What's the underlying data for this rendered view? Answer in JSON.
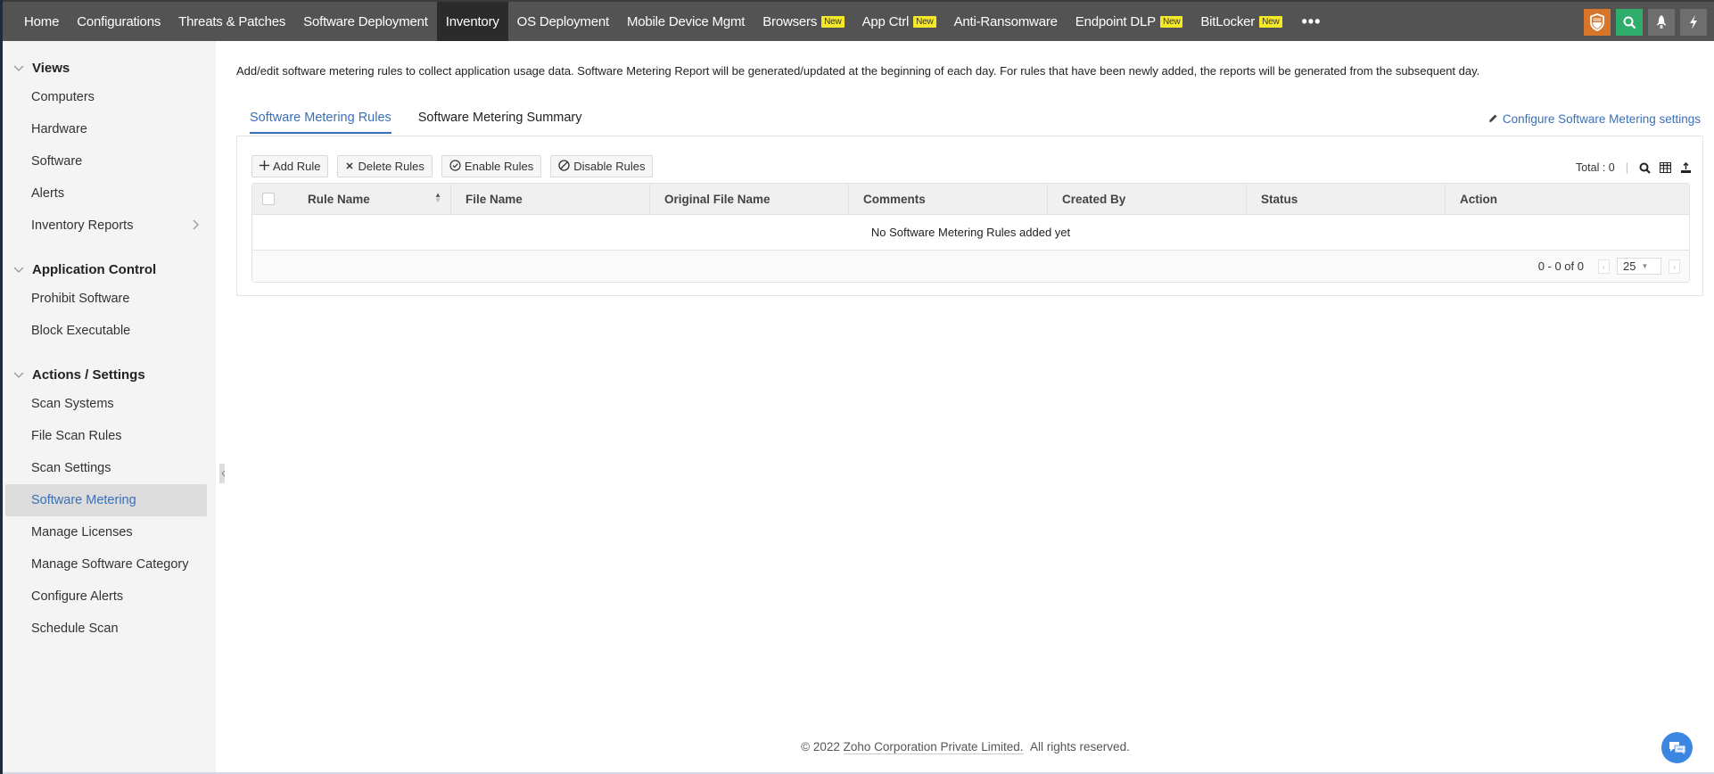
{
  "topnav": {
    "items": [
      {
        "label": "Home",
        "active": false
      },
      {
        "label": "Configurations",
        "active": false
      },
      {
        "label": "Threats & Patches",
        "active": false
      },
      {
        "label": "Software Deployment",
        "active": false
      },
      {
        "label": "Inventory",
        "active": true
      },
      {
        "label": "OS Deployment",
        "active": false
      },
      {
        "label": "Mobile Device Mgmt",
        "active": false
      },
      {
        "label": "Browsers",
        "badge": "New"
      },
      {
        "label": "App Ctrl",
        "badge": "New"
      },
      {
        "label": "Anti-Ransomware"
      },
      {
        "label": "Endpoint DLP",
        "badge": "New"
      },
      {
        "label": "BitLocker",
        "badge": "New"
      }
    ],
    "more": "•••",
    "right_icons": [
      "shield-icon",
      "search-icon",
      "rocket-icon",
      "lightning-icon"
    ],
    "colors": {
      "shield": "#d7762a",
      "search": "#2eae6a"
    }
  },
  "sidebar": {
    "sections": [
      {
        "title": "Views",
        "items": [
          "Computers",
          "Hardware",
          "Software",
          "Alerts",
          "Inventory Reports"
        ]
      },
      {
        "title": "Application Control",
        "items": [
          "Prohibit Software",
          "Block Executable"
        ]
      },
      {
        "title": "Actions / Settings",
        "items": [
          "Scan Systems",
          "File Scan Rules",
          "Scan Settings",
          "Software Metering",
          "Manage Licenses",
          "Manage Software Category",
          "Configure Alerts",
          "Schedule Scan"
        ]
      }
    ],
    "selected": "Software Metering"
  },
  "main": {
    "description": "Add/edit software metering rules to collect application usage data. Software Metering Report will be generated/updated at the beginning of each day. For rules that have been newly added, the reports will be generated from the subsequent day.",
    "tabs": [
      {
        "label": "Software Metering Rules",
        "active": true
      },
      {
        "label": "Software Metering Summary",
        "active": false
      }
    ],
    "config_link": "Configure Software Metering settings",
    "toolbar": {
      "add": "Add Rule",
      "delete": "Delete Rules",
      "enable": "Enable Rules",
      "disable": "Disable Rules"
    },
    "total_label": "Total : 0",
    "table": {
      "columns": [
        "Rule Name",
        "File Name",
        "Original File Name",
        "Comments",
        "Created By",
        "Status",
        "Action"
      ],
      "empty_message": "No Software Metering Rules added yet",
      "pagination": {
        "range": "0 - 0 of 0",
        "page_size": "25"
      }
    }
  },
  "footer": {
    "copyright": "© 2022",
    "company": "Zoho Corporation Private Limited.",
    "rights": "All rights reserved."
  },
  "accent_color": "#3a6fb7"
}
